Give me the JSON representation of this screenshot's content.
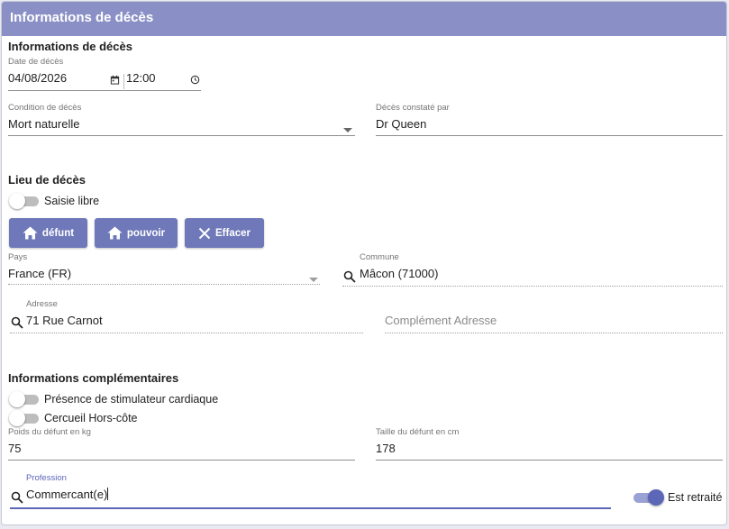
{
  "header": {
    "title": "Informations de décès"
  },
  "deces": {
    "section_title": "Informations de décès",
    "date_label": "Date de décès",
    "date_value": "04/08/2026",
    "time_value": "12:00",
    "condition_label": "Condition de décès",
    "condition_value": "Mort naturelle",
    "constate_label": "Décès constaté par",
    "constate_value": "Dr Queen"
  },
  "lieu": {
    "section_title": "Lieu de décès",
    "saisie_libre_label": "Saisie libre",
    "saisie_libre_on": false,
    "buttons": {
      "defunt": "défunt",
      "pouvoir": "pouvoir",
      "effacer": "Effacer"
    },
    "pays_label": "Pays",
    "pays_value": "France (FR)",
    "commune_label": "Commune",
    "commune_value": "Mâcon (71000)",
    "adresse_label": "Adresse",
    "adresse_value": "71 Rue Carnot",
    "complement_placeholder": "Complément Adresse"
  },
  "complementaires": {
    "section_title": "Informations complémentaires",
    "stimulateur_label": "Présence de stimulateur cardiaque",
    "stimulateur_on": false,
    "cercueil_label": "Cercueil Hors-côte",
    "cercueil_on": false,
    "poids_label": "Poids du défunt en kg",
    "poids_value": "75",
    "taille_label": "Taille du défunt en cm",
    "taille_value": "178",
    "profession_label": "Profession",
    "profession_value": "Commercant(e)",
    "retraite_label": "Est retraité",
    "retraite_on": true
  },
  "colors": {
    "header": "#8a90c6",
    "button": "#6f79b9",
    "accent": "#5c67b8"
  },
  "icons": [
    "calendar-icon",
    "clock-icon",
    "dropdown-arrow-icon",
    "home-icon",
    "close-icon",
    "search-icon"
  ]
}
